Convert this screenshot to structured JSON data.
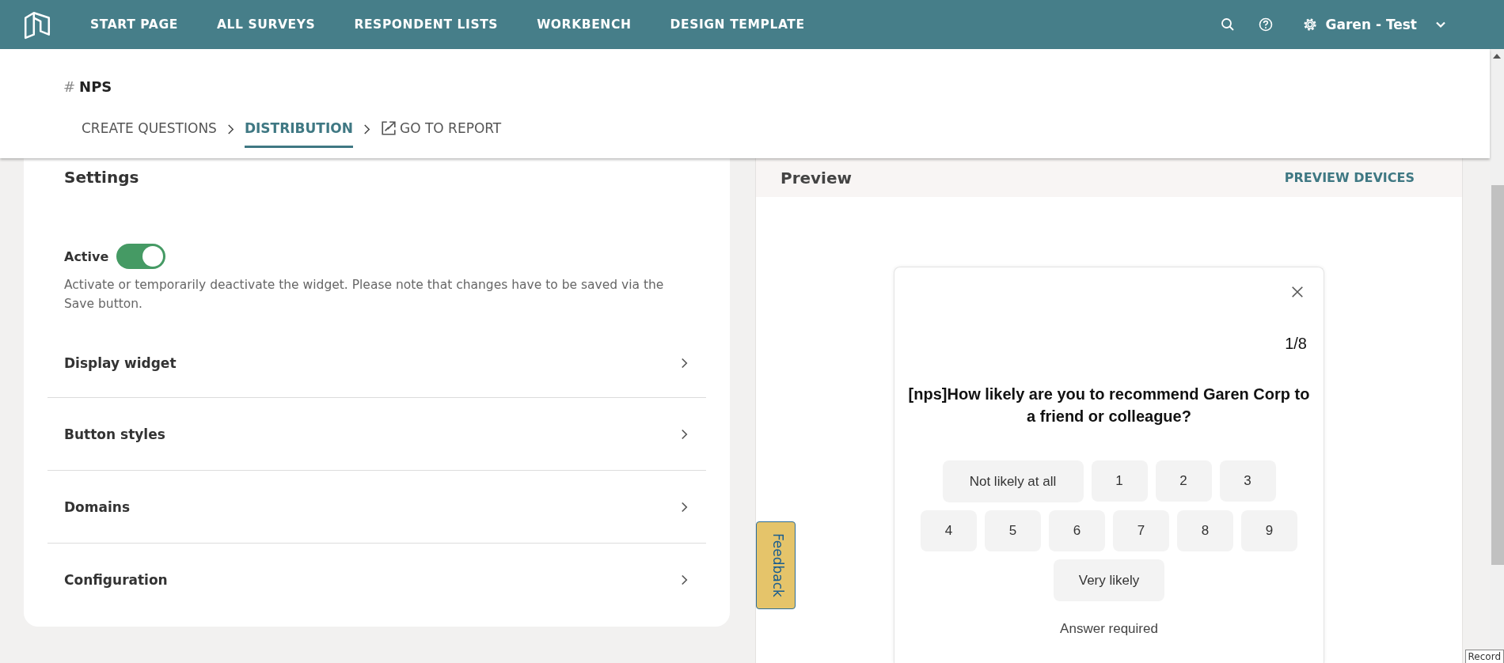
{
  "nav": {
    "items": [
      "START PAGE",
      "ALL SURVEYS",
      "RESPONDENT LISTS",
      "WORKBENCH",
      "DESIGN TEMPLATE"
    ],
    "user": "Garen - Test"
  },
  "survey": {
    "hash": "#",
    "title": "NPS"
  },
  "steps": [
    {
      "label": "CREATE QUESTIONS",
      "selected": false,
      "kind": "step"
    },
    {
      "label": "DISTRIBUTION",
      "selected": true,
      "kind": "step"
    },
    {
      "label": "GO TO REPORT",
      "selected": false,
      "kind": "external"
    }
  ],
  "settings": {
    "title": "Settings",
    "active": {
      "label": "Active",
      "on": true,
      "help": "Activate or temporarily deactivate the widget. Please note that changes have to be saved via the Save button."
    },
    "sections": [
      "Display widget",
      "Button styles",
      "Domains",
      "Configuration"
    ]
  },
  "preview": {
    "title": "Preview",
    "devices": "PREVIEW DEVICES",
    "feedback": "Feedback",
    "widget": {
      "progress": "1/8",
      "question": "[nps]How likely are you to recommend Garen Corp to a friend or colleague?",
      "options": [
        "Not likely at all",
        "1",
        "2",
        "3",
        "4",
        "5",
        "6",
        "7",
        "8",
        "9",
        "Very likely"
      ],
      "note": "Answer required"
    }
  },
  "tooltip": "Record"
}
